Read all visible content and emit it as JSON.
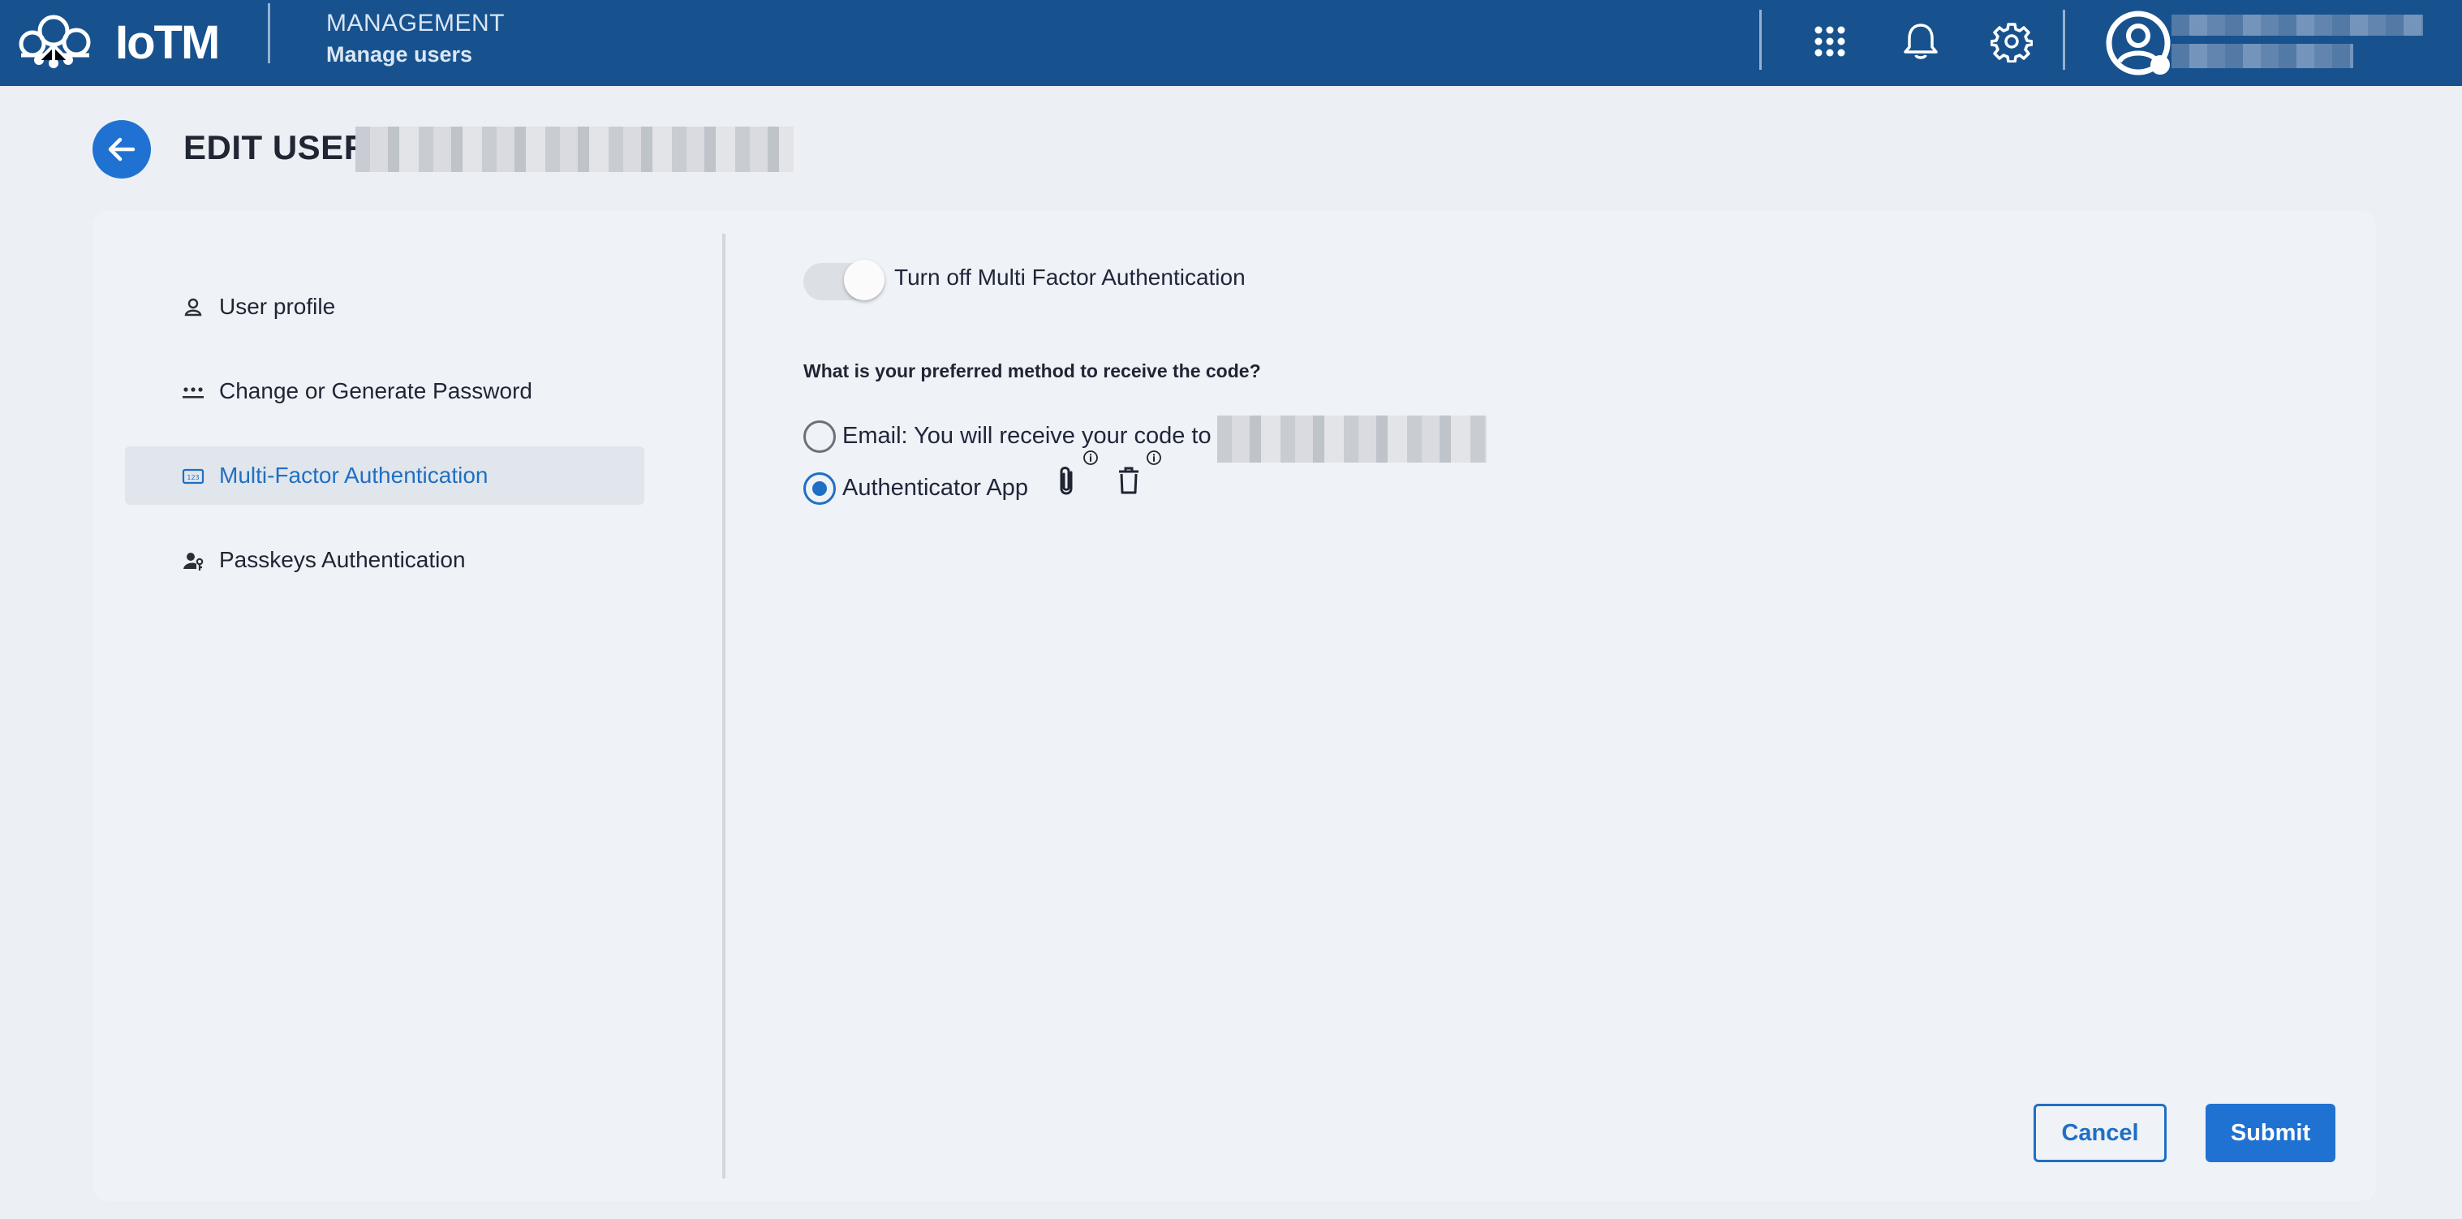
{
  "app": {
    "logo_text": "IoTM",
    "section_title": "MANAGEMENT",
    "section_subtitle": "Manage users",
    "icons": [
      "apps-grid-icon",
      "bell-icon",
      "gear-icon",
      "account-circle-icon"
    ]
  },
  "page": {
    "title": "EDIT USER:"
  },
  "sidebar": {
    "items": [
      {
        "label": "User profile",
        "icon": "person-icon",
        "active": false
      },
      {
        "label": "Change or Generate Password",
        "icon": "password-dots-icon",
        "active": false
      },
      {
        "label": "Multi-Factor Authentication",
        "icon": "pin-123-icon",
        "active": true
      },
      {
        "label": "Passkeys Authentication",
        "icon": "person-key-icon",
        "active": false
      }
    ]
  },
  "mfa": {
    "toggle_label": "Turn off Multi Factor Authentication",
    "toggle_on": true,
    "question": "What is your preferred method to receive the code?",
    "options": [
      {
        "label": "Email: You will receive your code to",
        "selected": false
      },
      {
        "label": "Authenticator App",
        "selected": true
      }
    ],
    "option_icons": [
      "attach-icon",
      "delete-icon",
      "info-icon"
    ]
  },
  "actions": {
    "cancel_label": "Cancel",
    "submit_label": "Submit"
  },
  "colors": {
    "topbar": "#17528e",
    "accent": "#1f72d1",
    "active_text": "#1f6fc4",
    "page_bg": "#eceff3",
    "card_bg": "#eff2f6"
  }
}
